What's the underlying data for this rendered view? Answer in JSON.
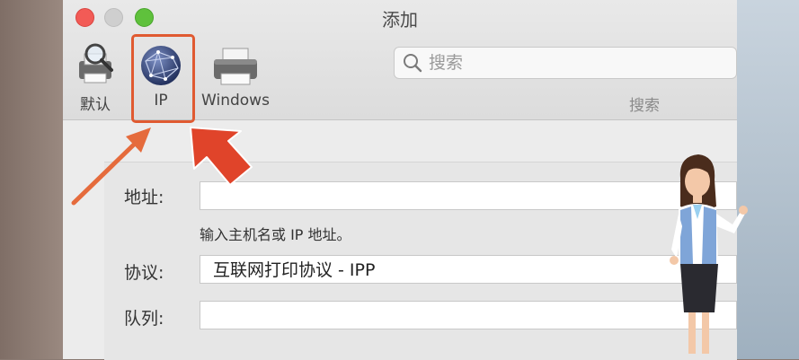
{
  "window": {
    "title": "添加"
  },
  "toolbar": {
    "items": [
      {
        "label": "默认",
        "icon": "printer-magnifier-icon"
      },
      {
        "label": "IP",
        "icon": "globe-icon"
      },
      {
        "label": "Windows",
        "icon": "printer-icon"
      }
    ]
  },
  "search": {
    "placeholder": "搜索",
    "label": "搜索"
  },
  "form": {
    "address_label": "地址:",
    "address_value": "",
    "hint": "输入主机名或 IP 地址。",
    "protocol_label": "协议:",
    "protocol_value": "互联网打印协议 - IPP",
    "queue_label": "队列:",
    "queue_value": ""
  },
  "colors": {
    "highlight": "#e05a31",
    "arrow": "#e0442a"
  }
}
